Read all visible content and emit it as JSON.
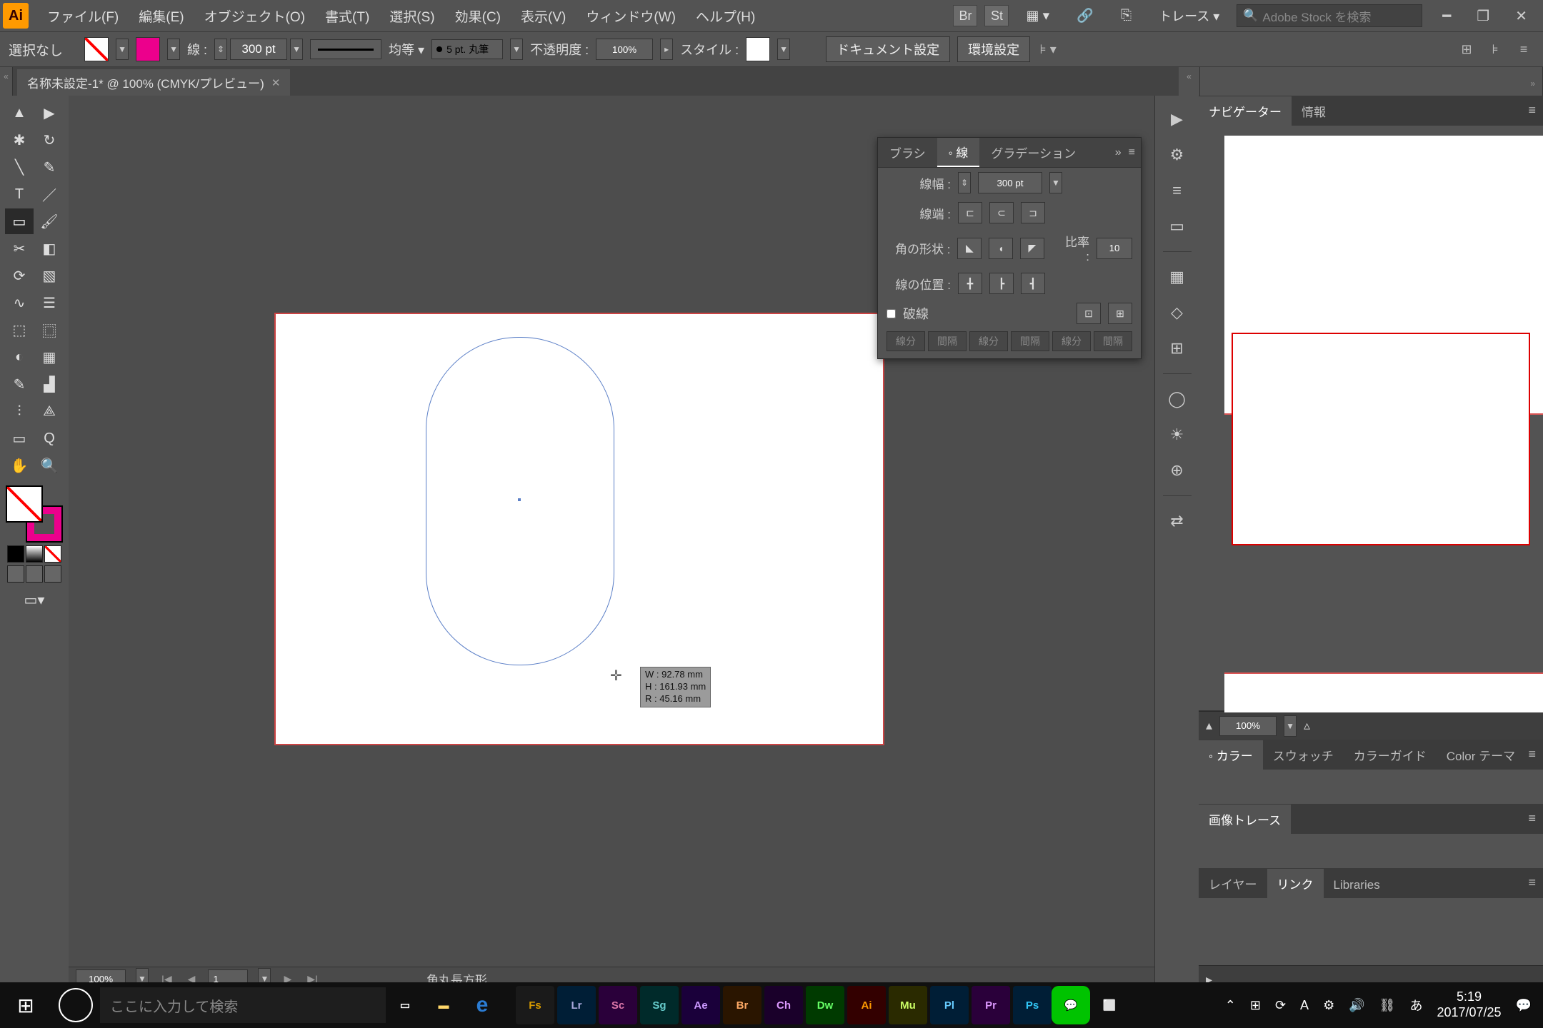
{
  "menubar": {
    "app": "Ai",
    "items": [
      "ファイル(F)",
      "編集(E)",
      "オブジェクト(O)",
      "書式(T)",
      "選択(S)",
      "効果(C)",
      "表示(V)",
      "ウィンドウ(W)",
      "ヘルプ(H)"
    ],
    "right_icons": [
      "Br",
      "St",
      "▦ ▾",
      "🔗",
      "⎘"
    ],
    "trace": "トレース ▾",
    "stock_placeholder": "Adobe Stock を検索",
    "window_ctrls": [
      "━",
      "❐",
      "✕"
    ]
  },
  "ctrlbar": {
    "no_selection": "選択なし",
    "stroke_label": "線 :",
    "stroke_weight": "300 pt",
    "uniform": "均等 ▾",
    "brush": "5 pt. 丸筆",
    "opacity_label": "不透明度 :",
    "opacity": "100%",
    "style_label": "スタイル :",
    "doc_setup": "ドキュメント設定",
    "prefs": "環境設定"
  },
  "tab": {
    "title": "名称未設定-1* @ 100% (CMYK/プレビュー)"
  },
  "tools": [
    [
      "▲",
      "▶"
    ],
    [
      "✱",
      "↻"
    ],
    [
      "╲",
      "✎"
    ],
    [
      "T",
      "／"
    ],
    [
      "▭",
      "🖌"
    ],
    [
      "✂",
      "◧"
    ],
    [
      "⟳",
      "▧"
    ],
    [
      "∿",
      "☰"
    ],
    [
      "⬚",
      "⿴"
    ],
    [
      "◐",
      "▦"
    ],
    [
      "✎",
      "▟"
    ],
    [
      "⫶",
      "⟁"
    ],
    [
      "▭",
      "Q"
    ],
    [
      "✋",
      "🔍"
    ]
  ],
  "measure": {
    "w": "W : 92.78 mm",
    "h": "H : 161.93 mm",
    "r": "R : 45.16 mm"
  },
  "stroke_panel": {
    "tabs": [
      "ブラシ",
      "◦ 線",
      "グラデーション"
    ],
    "width_label": "線幅 :",
    "width": "300 pt",
    "cap_label": "線端 :",
    "corner_label": "角の形状 :",
    "ratio_label": "比率 :",
    "ratio": "10",
    "align_label": "線の位置 :",
    "dashed": "破線",
    "dash_cols": [
      "線分",
      "間隔",
      "線分",
      "間隔",
      "線分",
      "間隔"
    ]
  },
  "right_strip": [
    "▶",
    "⚙",
    "≡",
    "▭",
    "",
    "▦",
    "◇",
    "⊞",
    "",
    "◯",
    "☀",
    "⊕",
    "",
    "⇄"
  ],
  "right_panels": {
    "nav_tabs": [
      "ナビゲーター",
      "情報"
    ],
    "zoom": "100%",
    "color_tabs": [
      "◦ カラー",
      "スウォッチ",
      "カラーガイド",
      "Color テーマ"
    ],
    "trace": "画像トレース",
    "layer_tabs": [
      "レイヤー",
      "リンク",
      "Libraries"
    ]
  },
  "status": {
    "zoom": "100%",
    "page": "1",
    "tool": "角丸長方形"
  },
  "taskbar": {
    "search": "ここに入力して検索",
    "adobe": [
      {
        "t": "Fs",
        "c": "#1a1a1a",
        "f": "#d89b00"
      },
      {
        "t": "Lr",
        "c": "#001e36",
        "f": "#aad"
      },
      {
        "t": "Sc",
        "c": "#2a003a",
        "f": "#d7a"
      },
      {
        "t": "Sg",
        "c": "#002a2a",
        "f": "#6cc"
      },
      {
        "t": "Ae",
        "c": "#1a003a",
        "f": "#c9f"
      },
      {
        "t": "Br",
        "c": "#2a1500",
        "f": "#fa6"
      },
      {
        "t": "Ch",
        "c": "#1a002a",
        "f": "#d9f"
      },
      {
        "t": "Dw",
        "c": "#003a00",
        "f": "#6f6"
      },
      {
        "t": "Ai",
        "c": "#330000",
        "f": "#ff9a00"
      },
      {
        "t": "Mu",
        "c": "#2a2a00",
        "f": "#cf6"
      },
      {
        "t": "Pl",
        "c": "#001e36",
        "f": "#6cf"
      },
      {
        "t": "Pr",
        "c": "#2a003a",
        "f": "#d9f"
      },
      {
        "t": "Ps",
        "c": "#001e36",
        "f": "#31c5f4"
      }
    ],
    "tray": [
      "⌃",
      "⊞",
      "⟳",
      "A",
      "⚙",
      "🔊",
      "⛓",
      "あ"
    ],
    "time": "5:19",
    "date": "2017/07/25"
  }
}
